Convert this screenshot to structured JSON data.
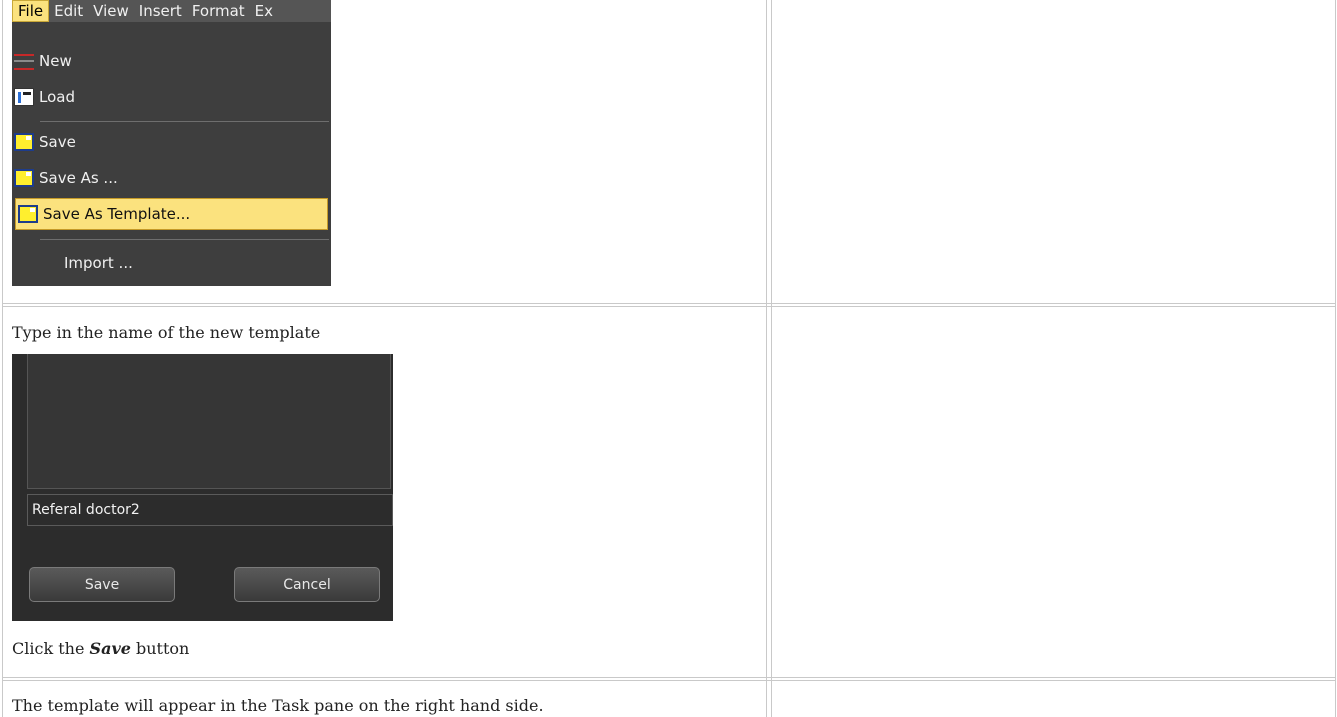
{
  "menu": {
    "menubar": [
      "File",
      "Edit",
      "View",
      "Insert",
      "Format",
      "Ex"
    ],
    "items": [
      {
        "label": "New",
        "icon": "new-icon"
      },
      {
        "label": "Load",
        "icon": "load-icon"
      },
      {
        "label": "Save",
        "icon": "save-icon"
      },
      {
        "label": "Save As ...",
        "icon": "save-as-icon"
      },
      {
        "label": "Save As Template...",
        "icon": "save-as-template-icon",
        "highlighted": true
      },
      {
        "label": "Import ..."
      }
    ]
  },
  "step2": {
    "instruction": "Type in the name of the new template",
    "dialog": {
      "name_value": "Referal doctor2",
      "save_label": "Save",
      "cancel_label": "Cancel"
    },
    "click_prefix": "Click the ",
    "click_bold": "Save",
    "click_suffix": " button"
  },
  "step3": {
    "text": "The template will appear in the Task pane on the right hand side."
  },
  "colors": {
    "highlight": "#fbe27e",
    "menu_bg": "#3e3e3e",
    "dialog_bg": "#2c2c2c",
    "table_border": "#c9c9c9"
  }
}
